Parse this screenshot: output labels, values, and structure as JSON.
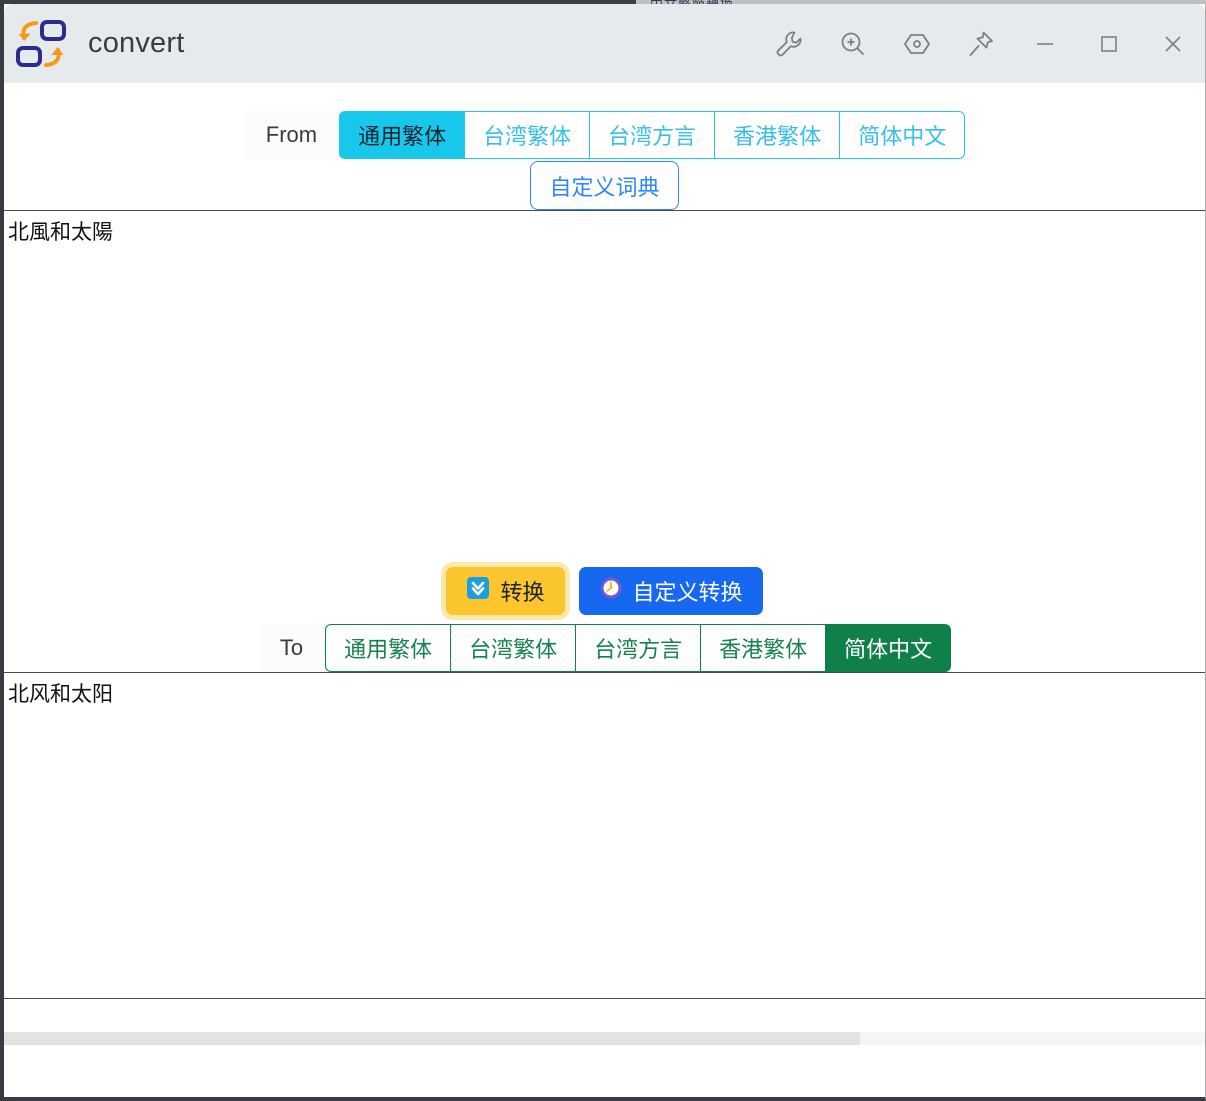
{
  "background_window": {
    "glyph_strip": "中文繁簡轉換"
  },
  "titlebar": {
    "app_name": "convert",
    "app_icon": "convert-arrows-icon",
    "actions": [
      {
        "name": "wrench-icon",
        "tooltip": "Tools"
      },
      {
        "name": "zoom-in-icon",
        "tooltip": "Zoom"
      },
      {
        "name": "hexagon-dot-icon",
        "tooltip": "Settings"
      },
      {
        "name": "pin-icon",
        "tooltip": "Pin on top"
      },
      {
        "name": "minimize-icon",
        "tooltip": "Minimize"
      },
      {
        "name": "maximize-icon",
        "tooltip": "Maximize"
      },
      {
        "name": "close-icon",
        "tooltip": "Close"
      }
    ]
  },
  "from_section": {
    "label": "From",
    "options": [
      {
        "label": "通用繁体",
        "active": true
      },
      {
        "label": "台湾繁体",
        "active": false
      },
      {
        "label": "台湾方言",
        "active": false
      },
      {
        "label": "香港繁体",
        "active": false
      },
      {
        "label": "简体中文",
        "active": false
      }
    ],
    "dictionary_button": "自定义词典"
  },
  "input_pane": {
    "text": "北風和太陽",
    "placeholder": ""
  },
  "actions": {
    "convert": {
      "label": "转换",
      "icon": "download-arrow-icon"
    },
    "custom_convert": {
      "label": "自定义转换",
      "icon": "clock-icon"
    }
  },
  "to_section": {
    "label": "To",
    "options": [
      {
        "label": "通用繁体",
        "active": false
      },
      {
        "label": "台湾繁体",
        "active": false
      },
      {
        "label": "台湾方言",
        "active": false
      },
      {
        "label": "香港繁体",
        "active": false
      },
      {
        "label": "简体中文",
        "active": true
      }
    ]
  },
  "output_pane": {
    "text": "北风和太阳",
    "placeholder": ""
  },
  "colors": {
    "titlebar_bg": "#e5eaed",
    "from_accent": "#17c7ec",
    "to_accent": "#10804b",
    "dict_accent": "#2f86ff",
    "convert_bg": "#fbc52d",
    "custom_convert_bg": "#1668f0",
    "window_border": "#3a3a42"
  }
}
